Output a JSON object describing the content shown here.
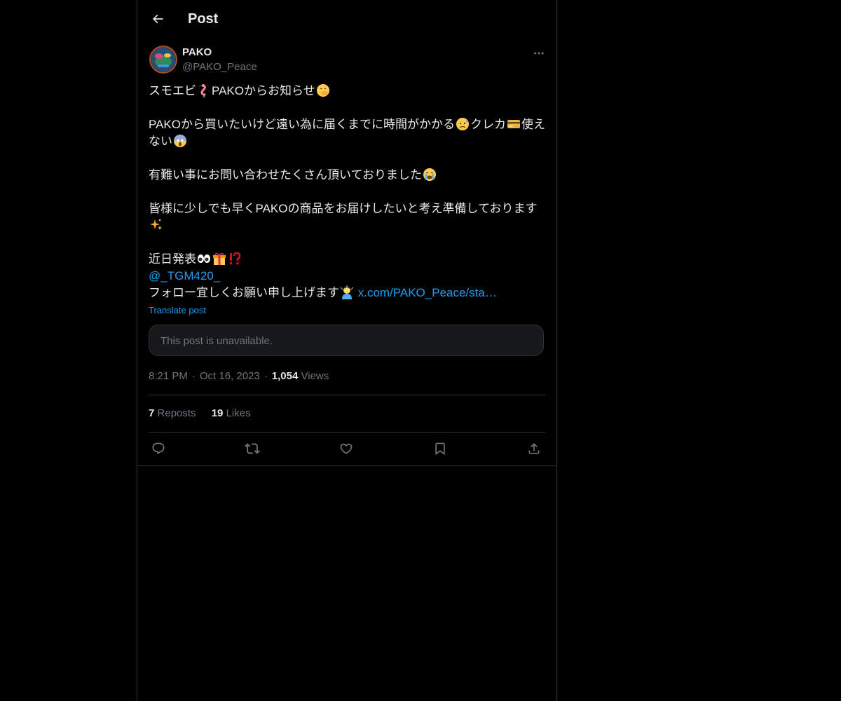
{
  "header": {
    "title": "Post"
  },
  "post": {
    "author_name": "PAKO",
    "author_handle": "@PAKO_Peace",
    "lines": {
      "l1": "スモエビ",
      "l1b": "PAKOからお知らせ",
      "l2": "PAKOから買いたいけど遠い為に届くまでに時間がかかる",
      "l2b": "クレカ",
      "l2c": "使え",
      "l2d": "ない",
      "l3": "有難い事にお問い合わせたくさん頂いておりました",
      "l4": "皆様に少しでも早くPAKOの商品をお届けしたいと考え準備しております",
      "l5": "近日発表",
      "mention": "@_TGM420_",
      "l6": "フォロー宜しくお願い申し上げます",
      "link": "x.com/PAKO_Peace/sta…"
    },
    "translate_label": "Translate post",
    "quoted_unavailable": "This post is unavailable.",
    "time": "8:21 PM",
    "date": "Oct 16, 2023",
    "views_count": "1,054",
    "views_label": "Views",
    "reposts_count": "7",
    "reposts_label": "Reposts",
    "likes_count": "19",
    "likes_label": "Likes"
  },
  "icons": {
    "back": "arrow-left-icon",
    "more": "more-horizontal-icon",
    "reply": "reply-icon",
    "repost": "repost-icon",
    "like": "heart-icon",
    "bookmark": "bookmark-icon",
    "share": "share-icon"
  },
  "colors": {
    "background": "#000000",
    "text": "#e7e9ea",
    "muted": "#71767b",
    "accent": "#1d9bf0",
    "border": "#2f3336"
  }
}
